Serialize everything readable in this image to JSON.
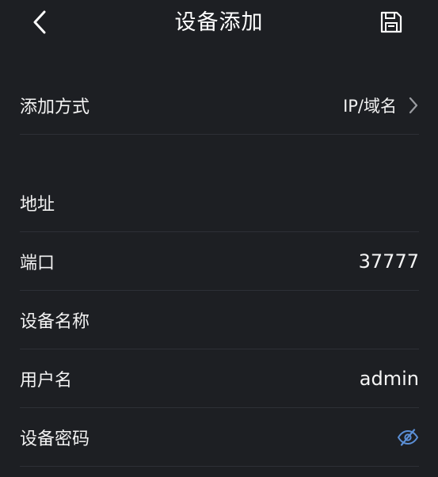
{
  "header": {
    "title": "设备添加",
    "back_icon": "chevron-left-icon",
    "save_icon": "floppy-disk-icon"
  },
  "form": {
    "add_method": {
      "label": "添加方式",
      "value": "IP/域名"
    },
    "address": {
      "label": "地址",
      "value": ""
    },
    "port": {
      "label": "端口",
      "value": "37777"
    },
    "device_name": {
      "label": "设备名称",
      "value": ""
    },
    "username": {
      "label": "用户名",
      "value": "admin"
    },
    "password": {
      "label": "设备密码",
      "value": "",
      "toggle_icon": "eye-off-icon"
    }
  },
  "colors": {
    "background": "#1d1f23",
    "text": "#ffffff",
    "accent": "#5b8fd6",
    "divider": "#2d3036"
  }
}
